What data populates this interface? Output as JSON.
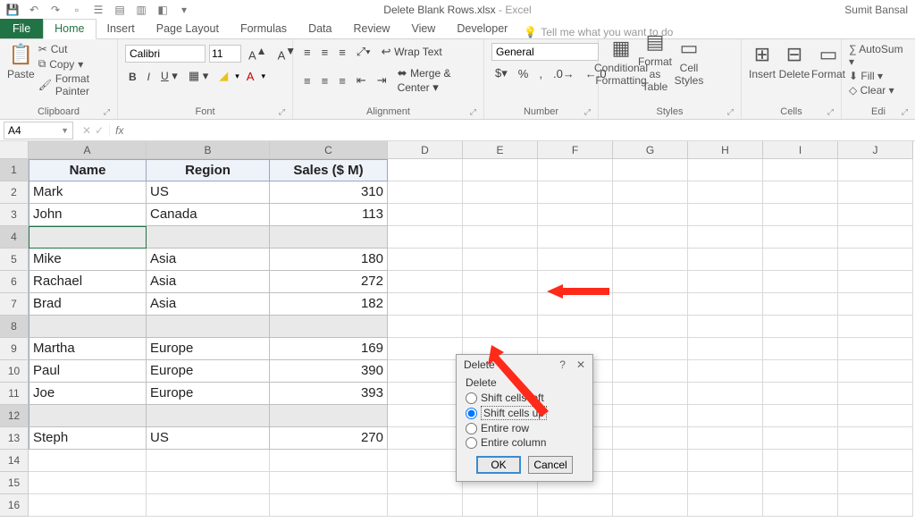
{
  "window": {
    "filename": "Delete Blank Rows.xlsx",
    "app": "Excel",
    "user": "Sumit Bansal"
  },
  "tabs": {
    "file": "File",
    "home": "Home",
    "items": [
      "Insert",
      "Page Layout",
      "Formulas",
      "Data",
      "Review",
      "View",
      "Developer"
    ],
    "tellme": "Tell me what you want to do"
  },
  "ribbon": {
    "clipboard": {
      "paste": "Paste",
      "cut": "Cut",
      "copy": "Copy",
      "painter": "Format Painter",
      "label": "Clipboard"
    },
    "font": {
      "name": "Calibri",
      "size": "11",
      "label": "Font"
    },
    "alignment": {
      "wrap": "Wrap Text",
      "merge": "Merge & Center",
      "label": "Alignment"
    },
    "number": {
      "format": "General",
      "label": "Number"
    },
    "styles": {
      "cond": "Conditional Formatting",
      "fat": "Format as Table",
      "cstyles": "Cell Styles",
      "label": "Styles"
    },
    "cells": {
      "insert": "Insert",
      "delete": "Delete",
      "format": "Format",
      "label": "Cells"
    },
    "editing": {
      "autosum": "AutoSum",
      "fill": "Fill",
      "clear": "Clear",
      "label": "Edi"
    }
  },
  "formula_bar": {
    "ref": "A4"
  },
  "columns": [
    "A",
    "B",
    "C",
    "D",
    "E",
    "F",
    "G",
    "H",
    "I",
    "J"
  ],
  "table": {
    "headers": [
      "Name",
      "Region",
      "Sales ($ M)"
    ],
    "rows": [
      {
        "n": 2,
        "blank": false,
        "cells": [
          "Mark",
          "US",
          "310"
        ]
      },
      {
        "n": 3,
        "blank": false,
        "cells": [
          "John",
          "Canada",
          "113"
        ]
      },
      {
        "n": 4,
        "blank": true,
        "cells": [
          "",
          "",
          ""
        ]
      },
      {
        "n": 5,
        "blank": false,
        "cells": [
          "Mike",
          "Asia",
          "180"
        ]
      },
      {
        "n": 6,
        "blank": false,
        "cells": [
          "Rachael",
          "Asia",
          "272"
        ]
      },
      {
        "n": 7,
        "blank": false,
        "cells": [
          "Brad",
          "Asia",
          "182"
        ]
      },
      {
        "n": 8,
        "blank": true,
        "cells": [
          "",
          "",
          ""
        ]
      },
      {
        "n": 9,
        "blank": false,
        "cells": [
          "Martha",
          "Europe",
          "169"
        ]
      },
      {
        "n": 10,
        "blank": false,
        "cells": [
          "Paul",
          "Europe",
          "390"
        ]
      },
      {
        "n": 11,
        "blank": false,
        "cells": [
          "Joe",
          "Europe",
          "393"
        ]
      },
      {
        "n": 12,
        "blank": true,
        "cells": [
          "",
          "",
          ""
        ]
      },
      {
        "n": 13,
        "blank": false,
        "cells": [
          "Steph",
          "US",
          "270"
        ]
      }
    ],
    "extra_rows": [
      14,
      15,
      16
    ]
  },
  "dialog": {
    "title": "Delete",
    "section": "Delete",
    "options": [
      {
        "label": "Shift cells left",
        "checked": false,
        "focus": false
      },
      {
        "label": "Shift cells up",
        "checked": true,
        "focus": true
      },
      {
        "label": "Entire row",
        "checked": false,
        "focus": false
      },
      {
        "label": "Entire column",
        "checked": false,
        "focus": false
      }
    ],
    "ok": "OK",
    "cancel": "Cancel"
  }
}
